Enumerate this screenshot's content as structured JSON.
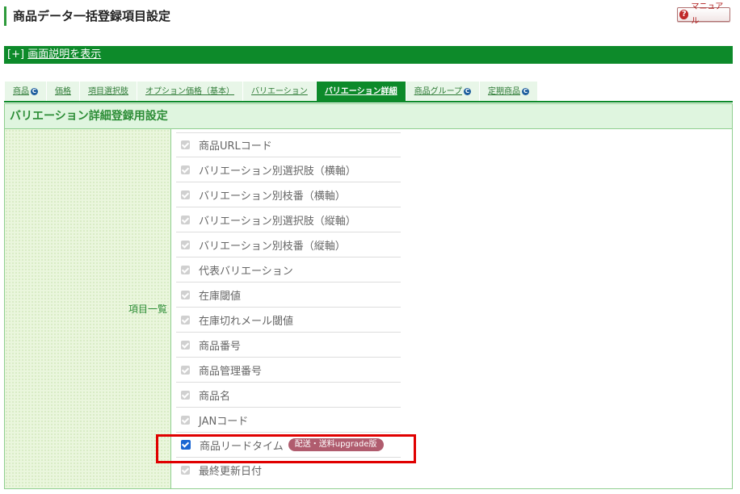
{
  "page": {
    "title": "商品データ一括登録項目設定"
  },
  "manual_button": {
    "icon": "?",
    "label": "マニュアル"
  },
  "description_bar": {
    "prefix": "[+]",
    "link": "画面説明を表示"
  },
  "tabs": [
    {
      "label": "商品",
      "icon": "c-icon",
      "active": false
    },
    {
      "label": "価格",
      "active": false
    },
    {
      "label": "項目選択肢",
      "active": false
    },
    {
      "label": "オプション価格（基本）",
      "active": false
    },
    {
      "label": "バリエーション",
      "active": false
    },
    {
      "label": "バリエーション詳細",
      "active": true
    },
    {
      "label": "商品グループ",
      "icon": "c-icon",
      "active": false
    },
    {
      "label": "定期商品",
      "icon": "c-icon",
      "active": false
    }
  ],
  "section": {
    "heading": "バリエーション詳細登録用設定",
    "row_label": "項目一覧",
    "items": [
      {
        "label": "商品URLコード",
        "checked": true,
        "disabled": true
      },
      {
        "label": "バリエーション別選択肢（横軸）",
        "checked": true,
        "disabled": true
      },
      {
        "label": "バリエーション別枝番（横軸）",
        "checked": true,
        "disabled": true
      },
      {
        "label": "バリエーション別選択肢（縦軸）",
        "checked": true,
        "disabled": true
      },
      {
        "label": "バリエーション別枝番（縦軸）",
        "checked": true,
        "disabled": true
      },
      {
        "label": "代表バリエーション",
        "checked": true,
        "disabled": true
      },
      {
        "label": "在庫閾値",
        "checked": true,
        "disabled": true
      },
      {
        "label": "在庫切れメール閾値",
        "checked": true,
        "disabled": true
      },
      {
        "label": "商品番号",
        "checked": true,
        "disabled": true
      },
      {
        "label": "商品管理番号",
        "checked": true,
        "disabled": true
      },
      {
        "label": "商品名",
        "checked": true,
        "disabled": true
      },
      {
        "label": "JANコード",
        "checked": true,
        "disabled": true
      },
      {
        "label": "商品リードタイム",
        "checked": true,
        "disabled": false,
        "badge": "配送・送料upgrade版"
      },
      {
        "label": "最終更新日付",
        "checked": true,
        "disabled": true
      }
    ]
  },
  "colors": {
    "accent_green": "#0d8a2a",
    "highlight_red": "#e00000",
    "badge": "#b05c6e",
    "checkbox_on": "#1a66d2"
  }
}
